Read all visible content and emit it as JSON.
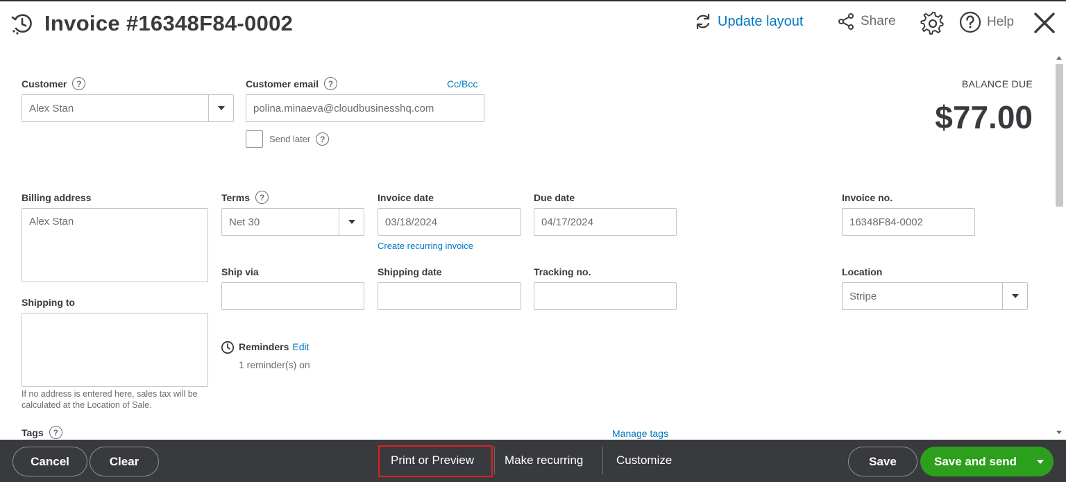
{
  "header": {
    "title": "Invoice #16348F84-0002",
    "update_layout": "Update layout",
    "share": "Share",
    "help": "Help"
  },
  "customer": {
    "label": "Customer",
    "value": "Alex Stan"
  },
  "customer_email": {
    "label": "Customer email",
    "value": "polina.minaeva@cloudbusinesshq.com",
    "cc_bcc": "Cc/Bcc",
    "send_later": "Send later"
  },
  "balance": {
    "label": "BALANCE DUE",
    "amount": "$77.00"
  },
  "billing": {
    "label": "Billing address",
    "value": "Alex Stan"
  },
  "terms": {
    "label": "Terms",
    "value": "Net 30"
  },
  "invoice_date": {
    "label": "Invoice date",
    "value": "03/18/2024",
    "recurring_link": "Create recurring invoice"
  },
  "due_date": {
    "label": "Due date",
    "value": "04/17/2024"
  },
  "invoice_no": {
    "label": "Invoice no.",
    "value": "16348F84-0002"
  },
  "ship_via": {
    "label": "Ship via",
    "value": ""
  },
  "shipping_date": {
    "label": "Shipping date",
    "value": ""
  },
  "tracking_no": {
    "label": "Tracking no.",
    "value": ""
  },
  "location": {
    "label": "Location",
    "value": "Stripe"
  },
  "shipping_to": {
    "label": "Shipping to",
    "value": "",
    "note_line1": "If no address is entered here, sales tax will be",
    "note_line2": "calculated at the Location of Sale."
  },
  "reminders": {
    "label": "Reminders",
    "edit": "Edit",
    "status": "1 reminder(s) on"
  },
  "tags": {
    "label": "Tags",
    "manage": "Manage tags"
  },
  "footer": {
    "cancel": "Cancel",
    "clear": "Clear",
    "print_preview": "Print or Preview",
    "make_recurring": "Make recurring",
    "customize": "Customize",
    "save": "Save",
    "save_and_send": "Save and send"
  },
  "colors": {
    "accent_blue": "#0077c5",
    "primary_green": "#2ca01c",
    "footer_bg": "#393a3d",
    "highlight_red": "#e02020"
  },
  "icons": [
    "history-icon",
    "refresh-icon",
    "share-icon",
    "gear-icon",
    "help-icon",
    "close-icon",
    "question-icon",
    "clock-icon",
    "chevron-down-icon"
  ]
}
